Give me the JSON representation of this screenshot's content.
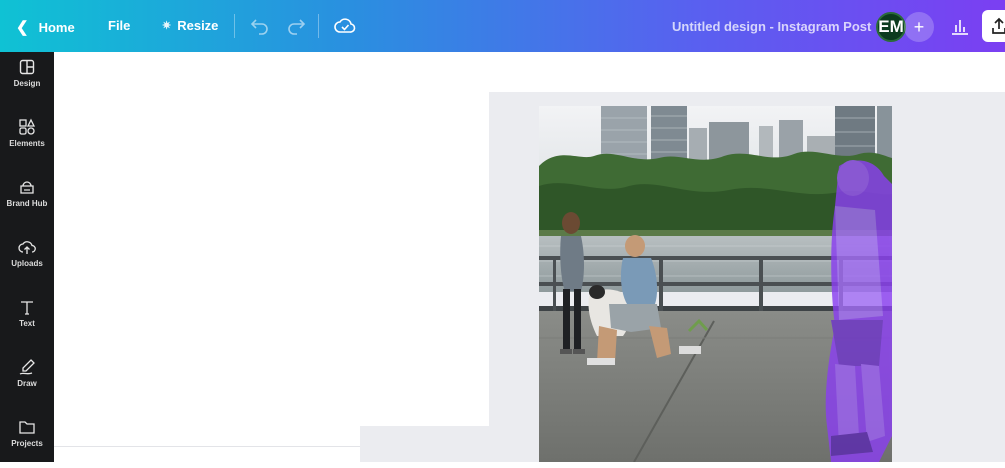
{
  "topbar": {
    "home_label": "Home",
    "file_label": "File",
    "resize_label": "Resize",
    "doc_title": "Untitled design - Instagram Post",
    "avatar_initials": "EM",
    "plus_label": "+",
    "icons": [
      "chevron-left-icon",
      "sparkle-icon",
      "undo-icon",
      "redo-icon",
      "cloud-check-icon",
      "plus-icon",
      "insights-icon",
      "share-icon"
    ],
    "gradient_colors": [
      "#0fc2d4",
      "#2a8fe0",
      "#5a5ff0",
      "#7b3ff2"
    ]
  },
  "sidebar": {
    "items": [
      {
        "label": "Design",
        "icon": "layout-icon"
      },
      {
        "label": "Elements",
        "icon": "shapes-icon"
      },
      {
        "label": "Brand Hub",
        "icon": "brand-icon"
      },
      {
        "label": "Uploads",
        "icon": "upload-cloud-icon"
      },
      {
        "label": "Text",
        "icon": "text-icon"
      },
      {
        "label": "Draw",
        "icon": "draw-icon"
      },
      {
        "label": "Projects",
        "icon": "folder-icon"
      }
    ]
  },
  "canvas": {
    "photo_description_icon": "photo-icon"
  }
}
